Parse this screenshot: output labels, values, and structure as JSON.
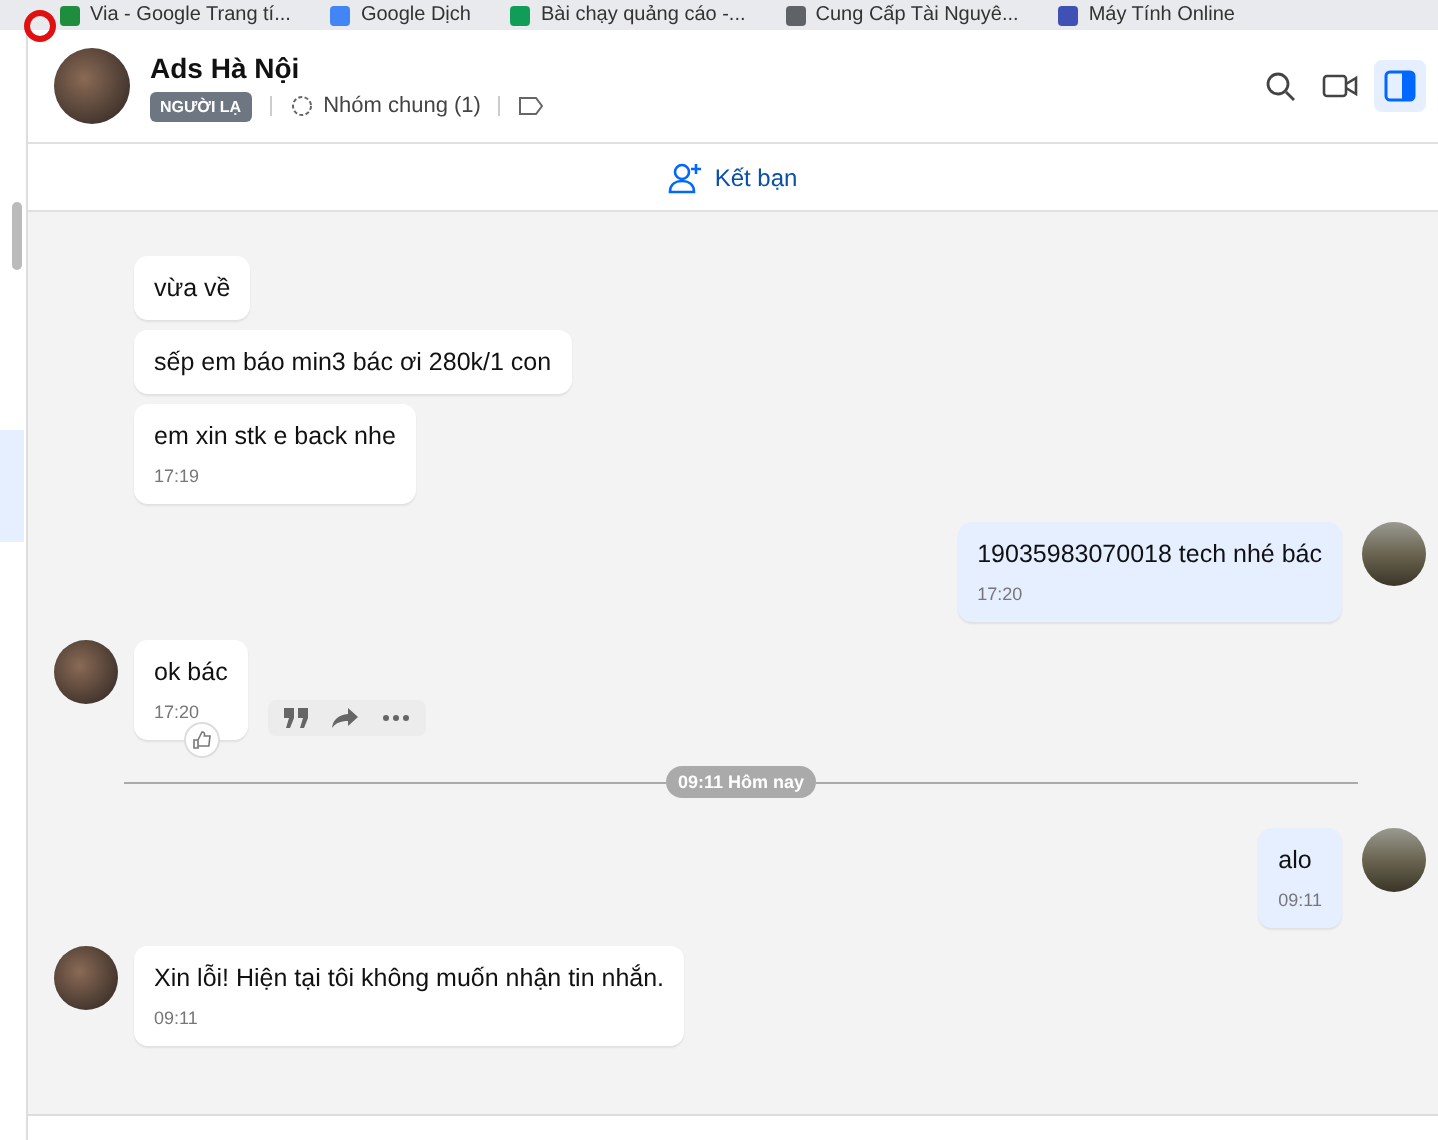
{
  "bookmarks": [
    {
      "label": "Via - Google Trang tí...",
      "color": "#1e8e3e"
    },
    {
      "label": "Google Dịch",
      "color": "#4285f4"
    },
    {
      "label": "Bài chạy quảng cáo -...",
      "color": "#0f9d58"
    },
    {
      "label": "Cung Cấp Tài Nguyê...",
      "color": "#5f6368"
    },
    {
      "label": "Máy Tính Online",
      "color": "#3f51b5"
    }
  ],
  "conversation": {
    "name": "Ads Hà Nội",
    "badge": "NGƯỜI LẠ",
    "group_info": "Nhóm chung (1)",
    "header_actions": [
      {
        "kind": "search",
        "selected": false
      },
      {
        "kind": "video",
        "selected": false
      },
      {
        "kind": "panel",
        "selected": true
      }
    ]
  },
  "add_friend": "Kết bạn",
  "messages": [
    {
      "kind": "received",
      "text": "vừa về",
      "avatar": false
    },
    {
      "kind": "received",
      "text": "sếp em báo min3 bác ơi 280k/1 con",
      "avatar": false
    },
    {
      "kind": "received",
      "text": "em xin stk e back nhe",
      "time": "17:19",
      "avatar": false
    },
    {
      "kind": "sent",
      "text": "19035983070018 tech nhé bác",
      "time": "17:20",
      "avatar": true
    },
    {
      "kind": "received",
      "text": "ok bác",
      "time": "17:20",
      "avatar": true,
      "liked": true,
      "actions": true
    },
    {
      "kind": "separator",
      "text": "09:11 Hôm nay"
    },
    {
      "kind": "sent",
      "text": "alo",
      "time": "09:11",
      "avatar": true
    },
    {
      "kind": "received",
      "text": "Xin lỗi! Hiện tại tôi không muốn nhận tin nhắn.",
      "time": "09:11",
      "avatar": true
    }
  ]
}
